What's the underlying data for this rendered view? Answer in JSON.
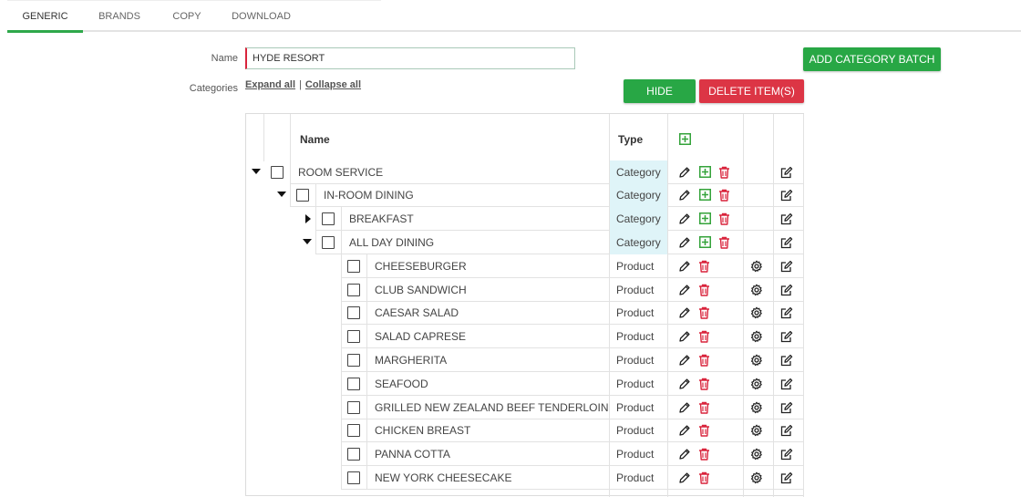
{
  "tabs": [
    {
      "label": "GENERIC",
      "active": true
    },
    {
      "label": "BRANDS",
      "active": false
    },
    {
      "label": "COPY",
      "active": false
    },
    {
      "label": "DOWNLOAD",
      "active": false
    }
  ],
  "form": {
    "name_label": "Name",
    "name_value": "HYDE RESORT",
    "categories_label": "Categories",
    "expand_all": "Expand all",
    "separator": "|",
    "collapse_all": "Collapse all"
  },
  "buttons": {
    "add_category_batch": "ADD CATEGORY BATCH",
    "hide": "HIDE",
    "delete_items": "DELETE ITEM(S)"
  },
  "table": {
    "header_name": "Name",
    "header_type": "Type",
    "rows": [
      {
        "name": "ROOM SERVICE",
        "type": "Category",
        "level": 0,
        "expander": "expanded"
      },
      {
        "name": "IN-ROOM DINING",
        "type": "Category",
        "level": 1,
        "expander": "expanded"
      },
      {
        "name": "BREAKFAST",
        "type": "Category",
        "level": 2,
        "expander": "collapsed"
      },
      {
        "name": "ALL DAY DINING",
        "type": "Category",
        "level": 2,
        "expander": "expanded"
      },
      {
        "name": "CHEESEBURGER",
        "type": "Product",
        "level": 3
      },
      {
        "name": "CLUB SANDWICH",
        "type": "Product",
        "level": 3
      },
      {
        "name": "CAESAR SALAD",
        "type": "Product",
        "level": 3
      },
      {
        "name": "SALAD CAPRESE",
        "type": "Product",
        "level": 3
      },
      {
        "name": "MARGHERITA",
        "type": "Product",
        "level": 3
      },
      {
        "name": "SEAFOOD",
        "type": "Product",
        "level": 3
      },
      {
        "name": "GRILLED NEW ZEALAND BEEF TENDERLOIN",
        "type": "Product",
        "level": 3
      },
      {
        "name": "CHICKEN BREAST",
        "type": "Product",
        "level": 3
      },
      {
        "name": "PANNA COTTA",
        "type": "Product",
        "level": 3
      },
      {
        "name": "NEW YORK CHEESECAKE",
        "type": "Product",
        "level": 3
      }
    ]
  },
  "colors": {
    "accent_green": "#28a745",
    "danger_red": "#dc3545",
    "category_bg": "#dff4f8"
  }
}
